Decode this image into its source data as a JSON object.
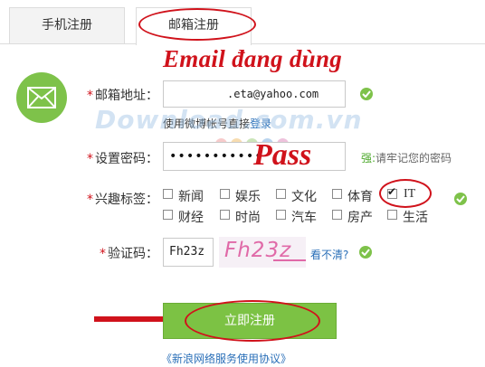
{
  "tabs": {
    "phone": "手机注册",
    "email": "邮箱注册"
  },
  "annotations": {
    "email_in_use": "Email đang dùng",
    "pass": "Pass"
  },
  "watermark": "Download.com.vn",
  "form": {
    "email_label": "邮箱地址：",
    "email_value": ".eta@yahoo.com",
    "weibo_hint_prefix": "使用微博帐号直接",
    "weibo_hint_link": "登录",
    "password_label": "设置密码：",
    "password_value": "•••••••••••",
    "strength_label": "强:",
    "strength_hint": "请牢记您的密码",
    "interests_label": "兴趣标签：",
    "interests": [
      {
        "label": "新闻",
        "checked": false
      },
      {
        "label": "娱乐",
        "checked": false
      },
      {
        "label": "文化",
        "checked": false
      },
      {
        "label": "体育",
        "checked": false
      },
      {
        "label": "IT",
        "checked": true
      },
      {
        "label": "财经",
        "checked": false
      },
      {
        "label": "时尚",
        "checked": false
      },
      {
        "label": "汽车",
        "checked": false
      },
      {
        "label": "房产",
        "checked": false
      },
      {
        "label": "生活",
        "checked": false
      }
    ],
    "captcha_label": "验证码：",
    "captcha_value": "Fh23z",
    "captcha_image_text": "Fh23z",
    "captcha_refresh": "看不清?",
    "submit": "立即注册",
    "agreement": "《新浪网络服务使用协议》"
  },
  "colors": {
    "annotation_red": "#d0121b",
    "accent_green": "#7cc244",
    "link_blue": "#2a6fb8"
  }
}
